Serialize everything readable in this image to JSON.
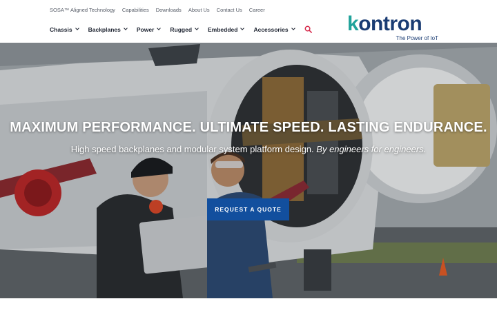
{
  "top_links": [
    "SOSA™ Aligned Technology",
    "Capabilities",
    "Downloads",
    "About Us",
    "Contact Us",
    "Career"
  ],
  "nav": {
    "items": [
      "Chassis",
      "Backplanes",
      "Power",
      "Rugged",
      "Embedded",
      "Accessories"
    ],
    "search_icon": "search-icon"
  },
  "logo": {
    "brand_k": "k",
    "brand_rest": "ontron",
    "tagline": "The Power of IoT",
    "colors": {
      "k": "#21a39b",
      "wordmark": "#1a3c73"
    }
  },
  "hero": {
    "headline": {
      "p1": "MAXIMUM ",
      "b1": "PERFORMANCE.",
      "p2": " ULTIMATE ",
      "b2": "SPEED.",
      "p3": " LASTING ",
      "b3": "ENDURANCE."
    },
    "subheadline": {
      "main": "High speed backplanes and modular system platform design.",
      "italic": "By engineers for engineers."
    },
    "cta_label": "REQUEST A QUOTE"
  },
  "colors": {
    "accent": "#124f9e",
    "nav_text": "#1d2330",
    "top_link_text": "#555b66",
    "search_icon": "#d6294a"
  }
}
